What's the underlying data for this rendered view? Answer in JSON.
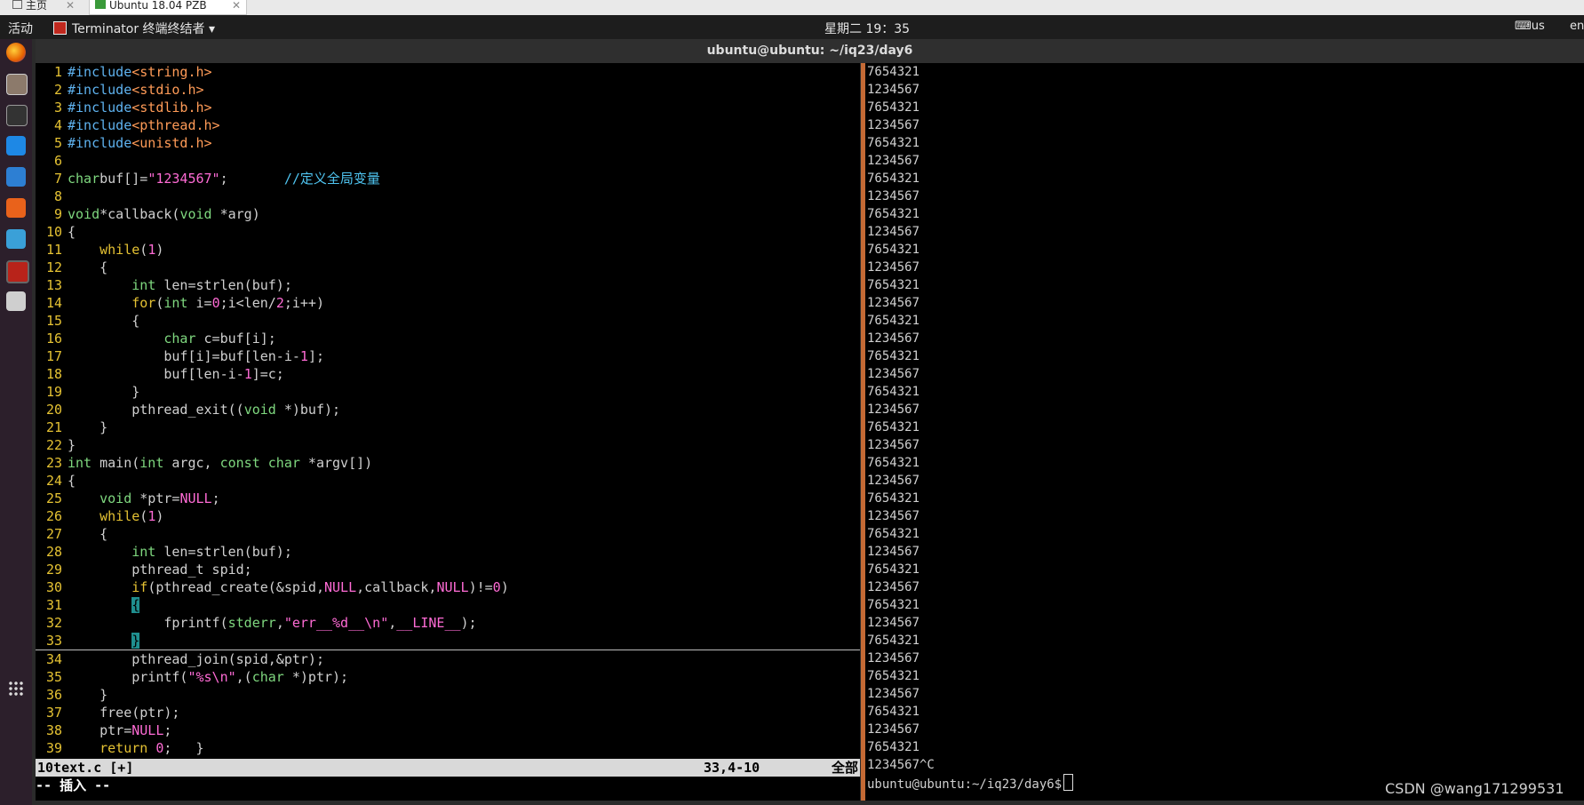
{
  "vm_tabs": {
    "home_label": "主页",
    "active_label": "Ubuntu 18.04 PZB",
    "close_glyph": "✕"
  },
  "topbar": {
    "activities": "活动",
    "app_menu": "Terminator 终端终结者 ▾",
    "clock": "星期二 19：35",
    "keyboard": "⌨us",
    "lang": "en"
  },
  "window_title": "ubuntu@ubuntu: ~/iq23/day6",
  "dock": [
    "firefox-icon",
    "files-icon",
    "terminal-icon",
    "vscode-icon",
    "v2-icon",
    "software-center-icon",
    "network-tool-icon",
    "terminator-icon",
    "search-tool-icon"
  ],
  "editor": {
    "cursor_line": 33,
    "lines": [
      {
        "n": "1",
        "segs": [
          [
            "p",
            "#include"
          ],
          [
            "s",
            "<string.h>"
          ]
        ]
      },
      {
        "n": "2",
        "segs": [
          [
            "p",
            "#include"
          ],
          [
            "s",
            "<stdio.h>"
          ]
        ]
      },
      {
        "n": "3",
        "segs": [
          [
            "p",
            "#include"
          ],
          [
            "s",
            "<stdlib.h>"
          ]
        ]
      },
      {
        "n": "4",
        "segs": [
          [
            "p",
            "#include"
          ],
          [
            "s",
            "<pthread.h>"
          ]
        ]
      },
      {
        "n": "5",
        "segs": [
          [
            "p",
            "#include"
          ],
          [
            "s",
            "<unistd.h>"
          ]
        ]
      },
      {
        "n": "6",
        "segs": []
      },
      {
        "n": "7",
        "segs": [
          [
            "t",
            "char"
          ],
          [
            "",
            "buf[]="
          ],
          [
            "n",
            "\"1234567\""
          ],
          [
            "",
            ";       "
          ],
          [
            "c",
            "//定义全局变量"
          ]
        ]
      },
      {
        "n": "8",
        "segs": []
      },
      {
        "n": "9",
        "segs": [
          [
            "t",
            "void"
          ],
          [
            "",
            ""
          ],
          [
            "",
            "*callback("
          ],
          [
            "t",
            "void"
          ],
          [
            "",
            " *arg)"
          ]
        ]
      },
      {
        "n": "10",
        "segs": [
          [
            "",
            "{"
          ]
        ]
      },
      {
        "n": "11",
        "segs": [
          [
            "",
            "    "
          ],
          [
            "k",
            "while"
          ],
          [
            "",
            "("
          ],
          [
            "n",
            "1"
          ],
          [
            "",
            ")"
          ]
        ]
      },
      {
        "n": "12",
        "segs": [
          [
            "",
            "    {"
          ]
        ]
      },
      {
        "n": "13",
        "segs": [
          [
            "",
            "        "
          ],
          [
            "t",
            "int"
          ],
          [
            "",
            " len=strlen(buf);"
          ]
        ]
      },
      {
        "n": "14",
        "segs": [
          [
            "",
            "        "
          ],
          [
            "k",
            "for"
          ],
          [
            "",
            "("
          ],
          [
            "t",
            "int"
          ],
          [
            "",
            " i="
          ],
          [
            "n",
            "0"
          ],
          [
            "",
            ";i<len/"
          ],
          [
            "n",
            "2"
          ],
          [
            "",
            ";i++)"
          ]
        ]
      },
      {
        "n": "15",
        "segs": [
          [
            "",
            "        {"
          ]
        ]
      },
      {
        "n": "16",
        "segs": [
          [
            "",
            "            "
          ],
          [
            "t",
            "char"
          ],
          [
            "",
            " c=buf[i];"
          ]
        ]
      },
      {
        "n": "17",
        "segs": [
          [
            "",
            "            buf[i]=buf[len-i-"
          ],
          [
            "n",
            "1"
          ],
          [
            "",
            "];"
          ]
        ]
      },
      {
        "n": "18",
        "segs": [
          [
            "",
            "            buf[len-i-"
          ],
          [
            "n",
            "1"
          ],
          [
            "",
            "]=c;"
          ]
        ]
      },
      {
        "n": "19",
        "segs": [
          [
            "",
            "        }"
          ]
        ]
      },
      {
        "n": "20",
        "segs": [
          [
            "",
            "        pthread_exit(("
          ],
          [
            "t",
            "void"
          ],
          [
            "",
            " *)buf);"
          ]
        ]
      },
      {
        "n": "21",
        "segs": [
          [
            "",
            "    }"
          ]
        ]
      },
      {
        "n": "22",
        "segs": [
          [
            "",
            "}"
          ]
        ]
      },
      {
        "n": "23",
        "segs": [
          [
            "t",
            "int"
          ],
          [
            "",
            " main("
          ],
          [
            "t",
            "int"
          ],
          [
            "",
            " argc, "
          ],
          [
            "t",
            "const"
          ],
          [
            "",
            " "
          ],
          [
            "t",
            "char"
          ],
          [
            "",
            " *argv[])"
          ]
        ]
      },
      {
        "n": "24",
        "segs": [
          [
            "",
            "{"
          ]
        ]
      },
      {
        "n": "25",
        "segs": [
          [
            "",
            "    "
          ],
          [
            "t",
            "void"
          ],
          [
            "",
            " *ptr="
          ],
          [
            "n",
            "NULL"
          ],
          [
            "",
            ";"
          ]
        ]
      },
      {
        "n": "26",
        "segs": [
          [
            "",
            "    "
          ],
          [
            "k",
            "while"
          ],
          [
            "",
            "("
          ],
          [
            "n",
            "1"
          ],
          [
            "",
            ")"
          ]
        ]
      },
      {
        "n": "27",
        "segs": [
          [
            "",
            "    {"
          ]
        ]
      },
      {
        "n": "28",
        "segs": [
          [
            "",
            "        "
          ],
          [
            "t",
            "int"
          ],
          [
            "",
            " len=strlen(buf);"
          ]
        ]
      },
      {
        "n": "29",
        "segs": [
          [
            "",
            "        pthread_t spid;"
          ]
        ]
      },
      {
        "n": "30",
        "segs": [
          [
            "",
            "        "
          ],
          [
            "k",
            "if"
          ],
          [
            "",
            "(pthread_create(&spid,"
          ],
          [
            "n",
            "NULL"
          ],
          [
            "",
            ",callback,"
          ],
          [
            "n",
            "NULL"
          ],
          [
            "",
            ")!="
          ],
          [
            "n",
            "0"
          ],
          [
            "",
            ")"
          ]
        ]
      },
      {
        "n": "31",
        "segs": [
          [
            "",
            "        "
          ],
          [
            "cur",
            "{"
          ]
        ]
      },
      {
        "n": "32",
        "segs": [
          [
            "",
            "            fprintf("
          ],
          [
            "t",
            "stderr"
          ],
          [
            "",
            ","
          ],
          [
            "n",
            "\"err__%d__\\n\""
          ],
          [
            "",
            ","
          ],
          [
            "n",
            "__LINE__"
          ],
          [
            "",
            ");"
          ]
        ]
      },
      {
        "n": "33",
        "segs": [
          [
            "",
            "        "
          ],
          [
            "cur",
            "}"
          ]
        ]
      },
      {
        "n": "34",
        "segs": [
          [
            "",
            "        pthread_join(spid,&ptr);"
          ]
        ]
      },
      {
        "n": "35",
        "segs": [
          [
            "",
            "        printf("
          ],
          [
            "n",
            "\"%s\\n\""
          ],
          [
            "",
            ",("
          ],
          [
            "t",
            "char"
          ],
          [
            "",
            " *)ptr);"
          ]
        ]
      },
      {
        "n": "36",
        "segs": [
          [
            "",
            "    }"
          ]
        ]
      },
      {
        "n": "37",
        "segs": [
          [
            "",
            "    free(ptr);"
          ]
        ]
      },
      {
        "n": "38",
        "segs": [
          [
            "",
            "    ptr="
          ],
          [
            "n",
            "NULL"
          ],
          [
            "",
            ";"
          ]
        ]
      },
      {
        "n": "39",
        "segs": [
          [
            "",
            "    "
          ],
          [
            "k",
            "return"
          ],
          [
            "",
            " "
          ],
          [
            "n",
            "0"
          ],
          [
            "",
            ";   }"
          ]
        ]
      }
    ]
  },
  "status": {
    "file": "10text.c [+]",
    "pos": "33,4-10",
    "pct": "全部"
  },
  "cmdline": "-- 插入 --",
  "output": [
    "7654321",
    "1234567",
    "7654321",
    "1234567",
    "7654321",
    "1234567",
    "7654321",
    "1234567",
    "7654321",
    "1234567",
    "7654321",
    "1234567",
    "7654321",
    "1234567",
    "7654321",
    "1234567",
    "7654321",
    "1234567",
    "7654321",
    "1234567",
    "7654321",
    "1234567",
    "7654321",
    "1234567",
    "7654321",
    "1234567",
    "7654321",
    "1234567",
    "7654321",
    "1234567",
    "7654321",
    "1234567",
    "7654321",
    "1234567",
    "7654321",
    "1234567",
    "7654321",
    "1234567",
    "7654321",
    "1234567^C"
  ],
  "prompt": "ubuntu@ubuntu:~/iq23/day6$",
  "watermark": "CSDN @wang171299531",
  "colors": {
    "divider": "#c46a35",
    "keyword": "#e5c233",
    "type": "#7fd87f",
    "number": "#ff6bd5",
    "string_include": "#ff9b57",
    "comment": "#4fc4f0",
    "preproc": "#5fb3f0"
  }
}
